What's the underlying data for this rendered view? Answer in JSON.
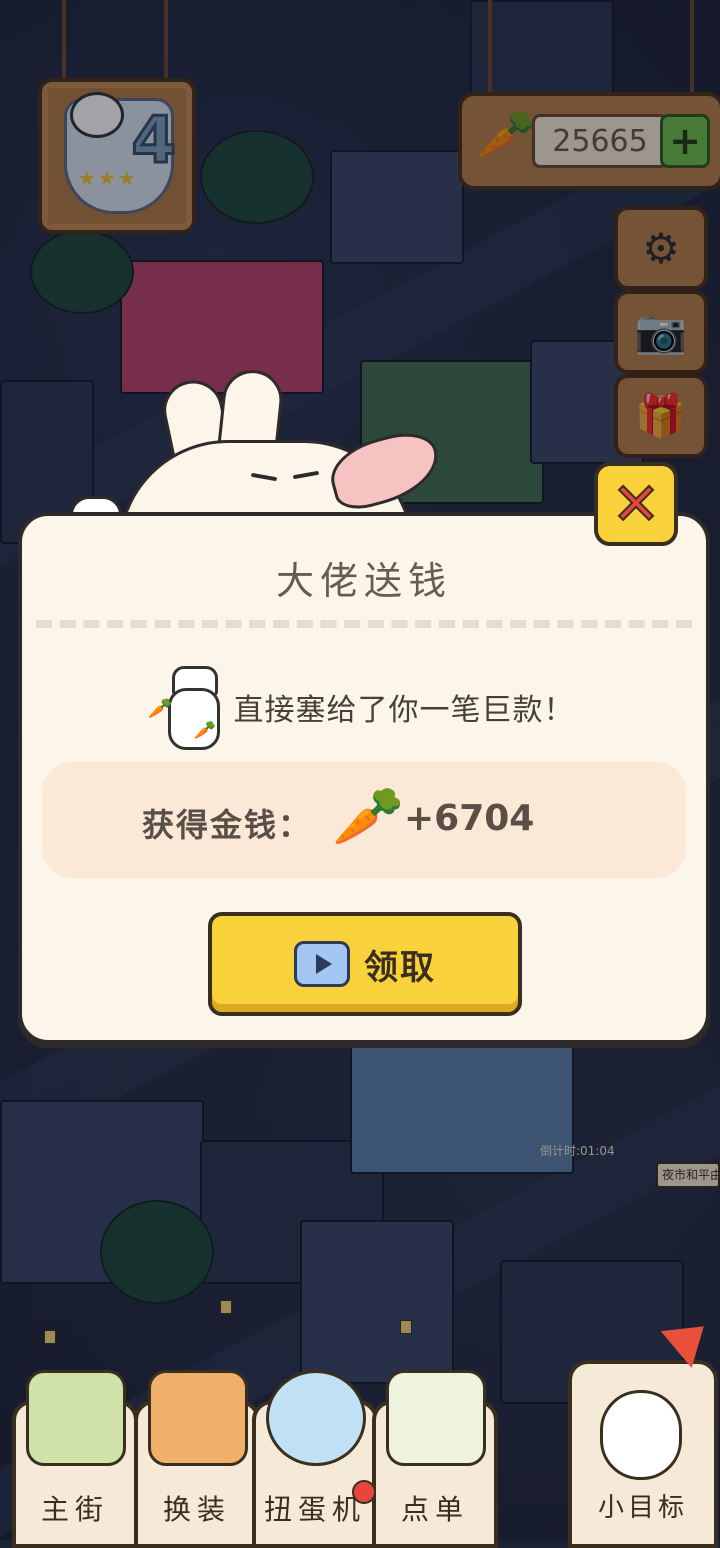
{
  "hud": {
    "level": "4",
    "level_stars": "★★★",
    "currency_amount": "25665",
    "currency_icon": "carrot-icon"
  },
  "dialog": {
    "title": "大佬送钱",
    "description": "直接塞给了你一笔巨款！",
    "reward_label": "获得金钱：",
    "reward_amount": "+6704",
    "claim_label": "领取"
  },
  "world": {
    "countdown": "倒计时:01:04",
    "market_sign": "夜市和平由"
  },
  "nav": {
    "items": [
      {
        "label": "主街"
      },
      {
        "label": "换装"
      },
      {
        "label": "扭蛋机"
      },
      {
        "label": "点单"
      }
    ],
    "goal_label": "小目标"
  },
  "colors": {
    "accent_yellow": "#f9d23b",
    "close_red": "#e8453c",
    "panel_cream": "#fbf5ea",
    "wood": "#b57f47"
  }
}
